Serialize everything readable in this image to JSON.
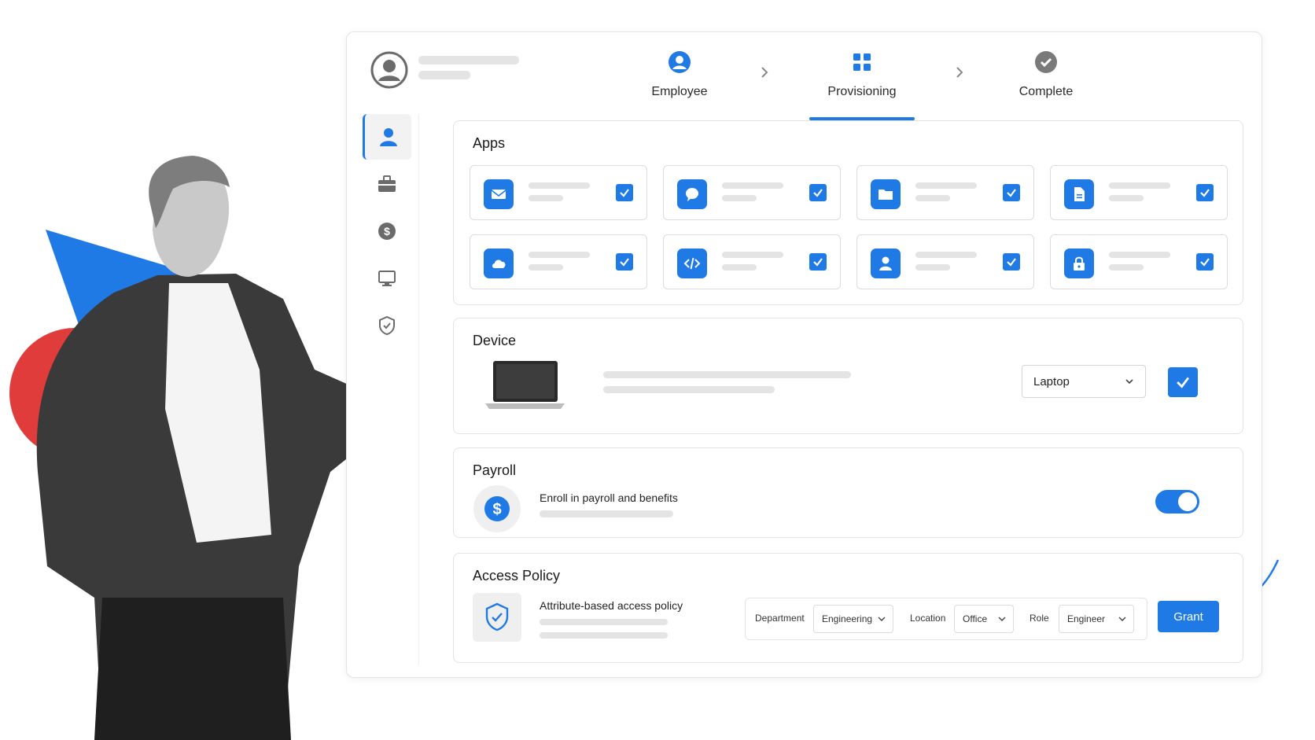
{
  "colors": {
    "accent": "#1f7ae6",
    "red_shape": "#e03c3c",
    "placeholder": "#e4e4e4"
  },
  "header": {
    "avatar_icon": "user-avatar-icon"
  },
  "stepper": {
    "steps": [
      {
        "label": "Employee",
        "icon": "person-circle-icon",
        "state": "done"
      },
      {
        "label": "Provisioning",
        "icon": "grid-icon",
        "state": "active"
      },
      {
        "label": "Complete",
        "icon": "check-circle-icon",
        "state": "pending"
      }
    ]
  },
  "sidebar": {
    "items": [
      {
        "icon": "user-icon",
        "active": true
      },
      {
        "icon": "briefcase-icon",
        "active": false
      },
      {
        "icon": "dollar-icon",
        "active": false
      },
      {
        "icon": "monitor-icon",
        "active": false
      },
      {
        "icon": "shield-check-icon",
        "active": false
      }
    ]
  },
  "apps": {
    "title": "Apps",
    "tiles": [
      {
        "icon": "mail-icon",
        "checked": true
      },
      {
        "icon": "chat-bubble-icon",
        "checked": true
      },
      {
        "icon": "folder-icon",
        "checked": true
      },
      {
        "icon": "document-icon",
        "checked": true
      },
      {
        "icon": "cloud-icon",
        "checked": true
      },
      {
        "icon": "code-icon",
        "checked": true
      },
      {
        "icon": "user-icon",
        "checked": true
      },
      {
        "icon": "lock-icon",
        "checked": true
      }
    ]
  },
  "device": {
    "title": "Device",
    "select_value": "Laptop",
    "checked": true
  },
  "payroll": {
    "title": "Payroll",
    "description": "Enroll in payroll and benefits",
    "toggle_on": true
  },
  "access_policy": {
    "title": "Access Policy",
    "description": "Attribute-based access policy",
    "department_label": "Department",
    "department_value": "Engineering",
    "location_label": "Location",
    "location_value": "Office",
    "role_label": "Role",
    "role_value": "Engineer",
    "grant_label": "Grant"
  }
}
